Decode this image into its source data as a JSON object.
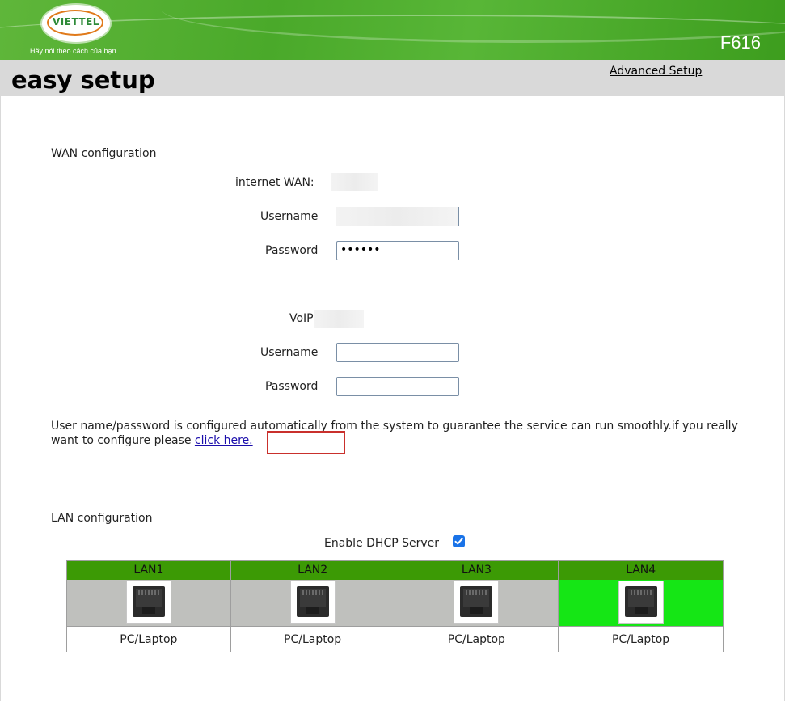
{
  "header": {
    "logo_text": "VIETTEL",
    "slogan": "Hãy nói theo cách của bạn",
    "model": "F616"
  },
  "titlebar": {
    "title": "easy setup",
    "advanced_link": "Advanced Setup"
  },
  "wan": {
    "section_title": "WAN configuration",
    "internet_label": "internet WAN:",
    "username_label": "Username",
    "password_label": "Password",
    "password_value": "••••••",
    "voip_label": "VoIP",
    "voip_username_label": "Username",
    "voip_password_label": "Password",
    "note_text": "User name/password is configured automatically from the system to guarantee the service can run smoothly.if you really want to configure please ",
    "note_link": "click here."
  },
  "lan": {
    "section_title": "LAN configuration",
    "dhcp_label": "Enable DHCP Server",
    "dhcp_checked": true,
    "ports": [
      {
        "name": "LAN1",
        "device": "PC/Laptop",
        "active": false
      },
      {
        "name": "LAN2",
        "device": "PC/Laptop",
        "active": false
      },
      {
        "name": "LAN3",
        "device": "PC/Laptop",
        "active": false
      },
      {
        "name": "LAN4",
        "device": "PC/Laptop",
        "active": true
      }
    ]
  },
  "colors": {
    "header_green": "#4aa92a",
    "lan_header_green": "#3c9a05",
    "active_port_green": "#15e615",
    "inactive_port_gray": "#bfc0bd",
    "highlight_red": "#c9302c",
    "link_blue": "#1a0dab"
  }
}
